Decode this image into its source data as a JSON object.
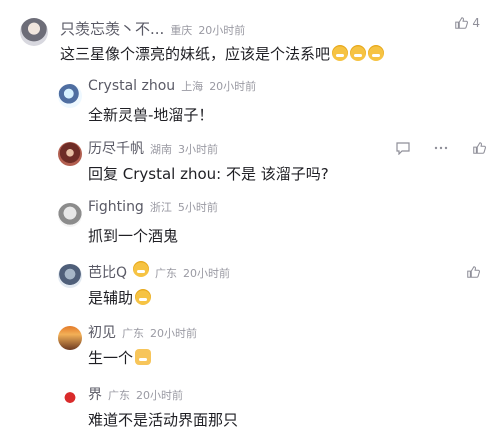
{
  "top_comment": {
    "username": "只羡忘羡丶不...",
    "location": "重庆",
    "time": "20小时前",
    "text": "这三星像个漂亮的妹纸，应该是个法系吧",
    "likes": "4"
  },
  "replies": [
    {
      "username": "Crystal zhou",
      "location": "上海",
      "time": "20小时前",
      "text": "全新灵兽-地溜子！"
    },
    {
      "username": "历尽千帆",
      "location": "湖南",
      "time": "3小时前",
      "text": "回复 Crystal zhou: 不是 该溜子吗?"
    },
    {
      "username": "Fighting",
      "location": "浙江",
      "time": "5小时前",
      "text": "抓到一个酒鬼"
    },
    {
      "username": "芭比Q",
      "location": "广东",
      "time": "20小时前",
      "text": "是辅助"
    },
    {
      "username": "初见",
      "location": "广东",
      "time": "20小时前",
      "text": "生一个"
    },
    {
      "username": "界",
      "location": "广东",
      "time": "20小时前",
      "text": "难道不是活动界面那只"
    }
  ],
  "icons": {
    "like": "thumb-up-icon",
    "reply": "comment-icon",
    "more": "ellipsis-icon"
  }
}
